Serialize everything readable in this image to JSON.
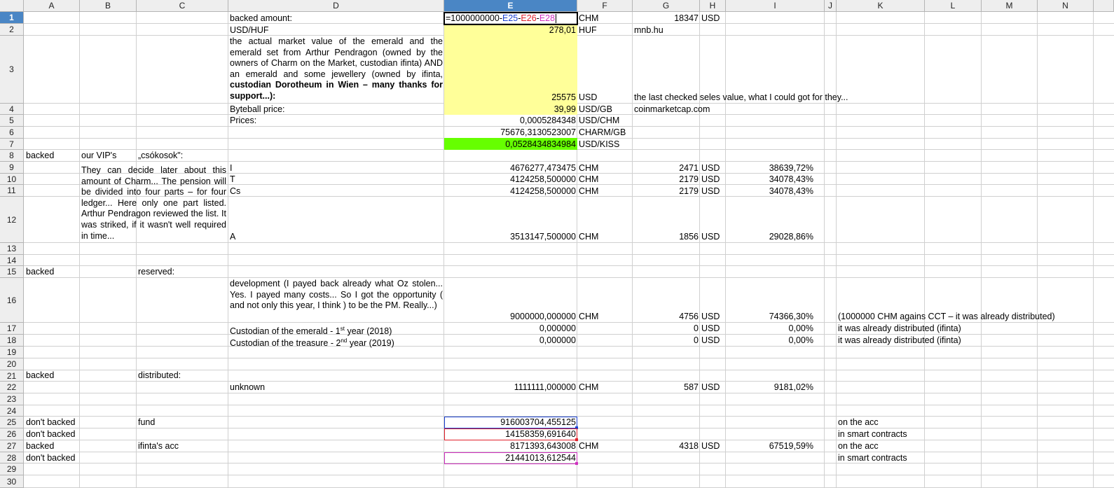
{
  "columns": [
    "A",
    "B",
    "C",
    "D",
    "E",
    "F",
    "G",
    "H",
    "I",
    "J",
    "K",
    "L",
    "M",
    "N",
    "O"
  ],
  "rows": [
    "1",
    "2",
    "3",
    "4",
    "5",
    "6",
    "7",
    "8",
    "9",
    "10",
    "11",
    "12",
    "13",
    "14",
    "15",
    "16",
    "17",
    "18",
    "19",
    "20",
    "21",
    "22",
    "23",
    "24",
    "25",
    "26",
    "27",
    "28",
    "29",
    "30"
  ],
  "selected_column": "E",
  "selected_row": "1",
  "formula": {
    "prefix": "=1000000000-",
    "ref1": "E25",
    "sep1": "-",
    "ref2": "E26",
    "sep2": "-",
    "ref3": "E28"
  },
  "cells": {
    "D1": "backed amount:",
    "F1": "CHM",
    "G1": "18347",
    "H1": "USD",
    "D2": "USD/HUF",
    "E2": "278,01",
    "F2": "HUF",
    "G2": "mnb.hu",
    "D3_plain": "the actual market value of the emerald and the emerald set from Arthur Pendragon (owned by the owners of Charm on the Market, custodian ifinta) AND an emerald and some jewellery (owned by ifinta, ",
    "D3_bold": "custodian Dorotheum in Wien – many thanks for support...",
    "D3_tail": "):",
    "E3": "25575",
    "F3": "USD",
    "G3": "the last checked seles value, what I could got for they...",
    "D4": "Byteball price:",
    "E4": "39,99",
    "F4": "USD/GB",
    "G4": "coinmarketcap.com",
    "D5": "Prices:",
    "E5": "0,0005284348",
    "F5": "USD/CHM",
    "E6": "75676,3130523007",
    "F6": "CHARM/GB",
    "E7": "0,0528434834984",
    "F7": "USD/KISS",
    "A8": "backed",
    "B8": "our VIP's",
    "C8": "„csókosok\":",
    "B9_text": "They can decide later about this amount of Charm... The pension will be divided into four parts – for four ledger... Here only one part listed. Arthur Pendragon reviewed the list. It was striked, if it wasn't well required in time...",
    "D9": "I",
    "E9": "4676277,473475",
    "F9": "CHM",
    "G9": "2471",
    "H9": "USD",
    "I9": "38639,72%",
    "D10": "T",
    "E10": "4124258,500000",
    "F10": "CHM",
    "G10": "2179",
    "H10": "USD",
    "I10": "34078,43%",
    "D11": "Cs",
    "E11": "4124258,500000",
    "F11": "CHM",
    "G11": "2179",
    "H11": "USD",
    "I11": "34078,43%",
    "D12": "A",
    "E12": "3513147,500000",
    "F12": "CHM",
    "G12": "1856",
    "H12": "USD",
    "I12": "29028,86%",
    "A15": "backed",
    "C15": "reserved:",
    "D16_text": "development (I payed back already what Oz stolen... Yes. I payed many costs... So I got the opportunity ( and not only this year, I think ) to be the PM. Really...)",
    "E16": "9000000,000000",
    "F16": "CHM",
    "G16": "4756",
    "H16": "USD",
    "I16": "74366,30%",
    "L16": "(1000000 CHM agains CCT – it was already distributed)",
    "D17_a": "Custodian of the emerald - 1",
    "D17_sup": "st",
    "D17_b": " year (2018)",
    "E17": "0,000000",
    "G17": "0",
    "H17": "USD",
    "I17": "0,00%",
    "L17": "it was already distributed (ifinta)",
    "D18_a": "Custodian of the treasure - 2",
    "D18_sup": "nd",
    "D18_b": " year (2019)",
    "E18": "0,000000",
    "G18": "0",
    "H18": "USD",
    "I18": "0,00%",
    "L18": "it was already distributed (ifinta)",
    "A21": "backed",
    "C21": "distributed:",
    "D22": "unknown",
    "E22": "1111111,000000",
    "F22": "CHM",
    "G22": "587",
    "H22": "USD",
    "I22": "9181,02%",
    "A25": "don't backed",
    "C25": "fund",
    "E25": "916003704,455125",
    "L25": "on the acc",
    "A26": "don't backed",
    "E26": "14158359,691640",
    "L26": "in smart contracts",
    "A27": "backed",
    "C27": "ifinta's acc",
    "E27": "8171393,643008",
    "F27": "CHM",
    "G27": "4318",
    "H27": "USD",
    "I27": "67519,59%",
    "L27": "on the acc",
    "A28": "don't backed",
    "E28": "21441013,612544",
    "L28": "in smart contracts"
  },
  "colors": {
    "yellow_fill": "#ffff99",
    "green_fill": "#66ff00",
    "ref_blue": "#1a40d0",
    "ref_red": "#e0202a",
    "ref_magenta": "#d030c0",
    "header_selected": "#4a86c5"
  }
}
